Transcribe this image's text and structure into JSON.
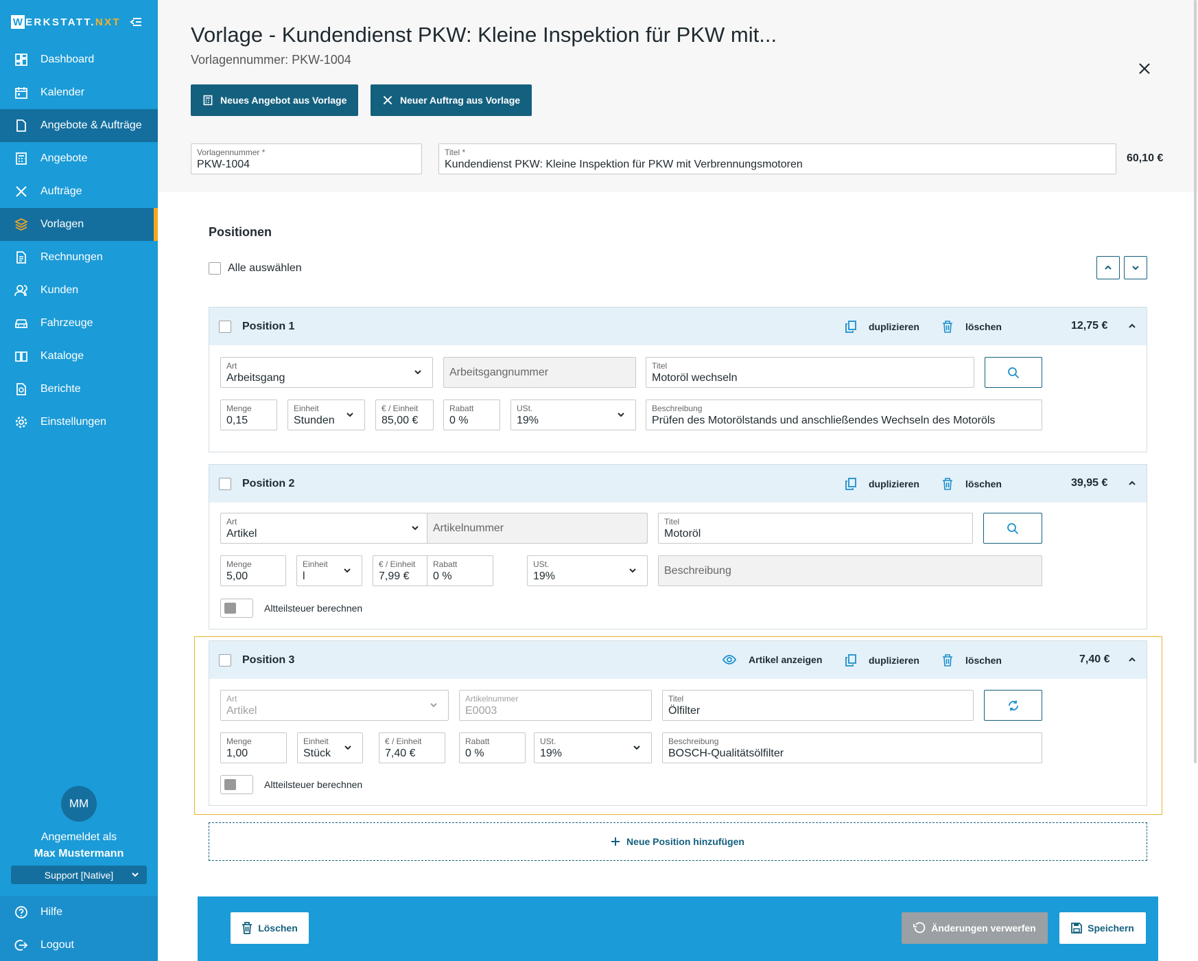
{
  "app": {
    "logo_letter": "W",
    "logo_main": "ERKSTATT.",
    "logo_accent": "NXT"
  },
  "colors": {
    "sidebar": "#1b9bd7",
    "sidebar_active": "#146f9f",
    "accent": "#f4a720",
    "button_dark": "#14607f",
    "card_header": "#e4f1f9",
    "highlight": "#e8b52c"
  },
  "sidebar": {
    "items": [
      {
        "label": "Dashboard",
        "icon": "dashboard-icon"
      },
      {
        "label": "Kalender",
        "icon": "calendar-icon"
      },
      {
        "label": "Angebote & Aufträge",
        "icon": "document-icon"
      },
      {
        "label": "Angebote",
        "icon": "calculator-icon"
      },
      {
        "label": "Aufträge",
        "icon": "tools-icon"
      },
      {
        "label": "Vorlagen",
        "icon": "layers-icon"
      },
      {
        "label": "Rechnungen",
        "icon": "invoice-icon"
      },
      {
        "label": "Kunden",
        "icon": "users-icon"
      },
      {
        "label": "Fahrzeuge",
        "icon": "car-icon"
      },
      {
        "label": "Kataloge",
        "icon": "book-icon"
      },
      {
        "label": "Berichte",
        "icon": "report-icon"
      },
      {
        "label": "Einstellungen",
        "icon": "gear-icon"
      }
    ],
    "user": {
      "initials": "MM",
      "logged_in_as": "Angemeldet als",
      "name": "Max Mustermann",
      "role": "Support [Native]"
    },
    "bottom": [
      {
        "label": "Hilfe",
        "icon": "help-icon"
      },
      {
        "label": "Logout",
        "icon": "logout-icon"
      }
    ]
  },
  "header": {
    "title": "Vorlage - Kundendienst PKW: Kleine Inspektion für PKW mit...",
    "subtitle": "Vorlagennummer: PKW-1004",
    "btn_offer": "Neues Angebot aus Vorlage",
    "btn_order": "Neuer Auftrag aus Vorlage",
    "number_label": "Vorlagennummer *",
    "number_value": "PKW-1004",
    "title_label": "Titel *",
    "title_value": "Kundendienst PKW: Kleine Inspektion für PKW mit Verbrennungsmotoren",
    "total": "60,10 €"
  },
  "positions_section": {
    "heading": "Positionen",
    "select_all": "Alle auswählen",
    "add_label": "Neue Position hinzufügen"
  },
  "actions": {
    "duplicate": "duplizieren",
    "delete": "löschen",
    "show_article": "Artikel anzeigen",
    "alt_tax": "Altteilsteuer berechnen"
  },
  "labels": {
    "art": "Art",
    "titel": "Titel",
    "menge": "Menge",
    "einheit": "Einheit",
    "preis": "€ / Einheit",
    "rabatt": "Rabatt",
    "ust": "USt.",
    "beschreibung": "Beschreibung",
    "artikelnummer": "Artikelnummer",
    "arbeitsgangnummer": "Arbeitsgangnummer"
  },
  "positions": [
    {
      "name": "Position 1",
      "price": "12,75 €",
      "art": "Arbeitsgang",
      "number": "",
      "title": "Motoröl wechseln",
      "menge": "0,15",
      "einheit": "Stunden",
      "preis": "85,00 €",
      "rabatt": "0 %",
      "ust": "19%",
      "beschreibung": "Prüfen des Motorölstands und anschließendes Wechseln des Motoröls"
    },
    {
      "name": "Position 2",
      "price": "39,95 €",
      "art": "Artikel",
      "number": "",
      "title": "Motoröl",
      "menge": "5,00",
      "einheit": "l",
      "preis": "7,99 €",
      "rabatt": "0 %",
      "ust": "19%",
      "beschreibung": ""
    },
    {
      "name": "Position 3",
      "price": "7,40 €",
      "art": "Artikel",
      "number": "E0003",
      "title": "Ölfilter",
      "menge": "1,00",
      "einheit": "Stück",
      "preis": "7,40 €",
      "rabatt": "0 %",
      "ust": "19%",
      "beschreibung": "BOSCH-Qualitätsölfilter"
    }
  ],
  "footer": {
    "delete": "Löschen",
    "discard": "Änderungen verwerfen",
    "save": "Speichern"
  }
}
